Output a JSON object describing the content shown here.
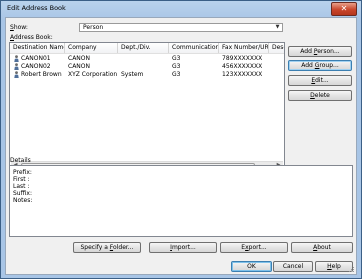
{
  "window": {
    "title": "Edit Address Book",
    "close_label": "✕"
  },
  "show": {
    "label_prefix": "",
    "label_underlined": "S",
    "label_suffix": "how:",
    "selected": "Person"
  },
  "address_book_label": {
    "prefix": "",
    "underlined": "A",
    "suffix": "ddress Book:"
  },
  "table": {
    "columns": [
      "Destination Name",
      "Company",
      "Dept./Div.",
      "Communication ...",
      "Fax Number/URI",
      "Desc"
    ],
    "rows": [
      {
        "name": "CANON01",
        "company": "CANON",
        "dept": "",
        "comm": "G3",
        "fax": "789XXXXXXX",
        "selected": false
      },
      {
        "name": "CANON02",
        "company": "CANON",
        "dept": "",
        "comm": "G3",
        "fax": "456XXXXXXX",
        "selected": false
      },
      {
        "name": "Robert Brown",
        "company": "XYZ Corporation",
        "dept": "System",
        "comm": "G3",
        "fax": "123XXXXXXX",
        "selected": false
      }
    ]
  },
  "side_buttons": {
    "add_person": {
      "prefix": "Add ",
      "underlined": "P",
      "suffix": "erson..."
    },
    "add_group": {
      "prefix": "Add ",
      "underlined": "G",
      "suffix": "roup..."
    },
    "edit": {
      "prefix": "",
      "underlined": "E",
      "suffix": "dit..."
    },
    "delete": {
      "prefix": "",
      "underlined": "D",
      "suffix": "elete"
    }
  },
  "details": {
    "label": "Details",
    "fields": [
      "Prefix:",
      "First :",
      "Last :",
      "Suffix:",
      "Notes:"
    ]
  },
  "bottom_buttons": {
    "specify_folder": {
      "prefix": "Specify a ",
      "underlined": "F",
      "suffix": "older..."
    },
    "import": {
      "prefix": "",
      "underlined": "I",
      "suffix": "mport..."
    },
    "export": {
      "prefix": "E",
      "underlined": "x",
      "suffix": "port..."
    },
    "about": {
      "prefix": "",
      "underlined": "A",
      "suffix": "bout"
    }
  },
  "dialog_buttons": {
    "ok": "OK",
    "cancel": "Cancel",
    "help": {
      "prefix": "",
      "underlined": "H",
      "suffix": "elp"
    }
  }
}
